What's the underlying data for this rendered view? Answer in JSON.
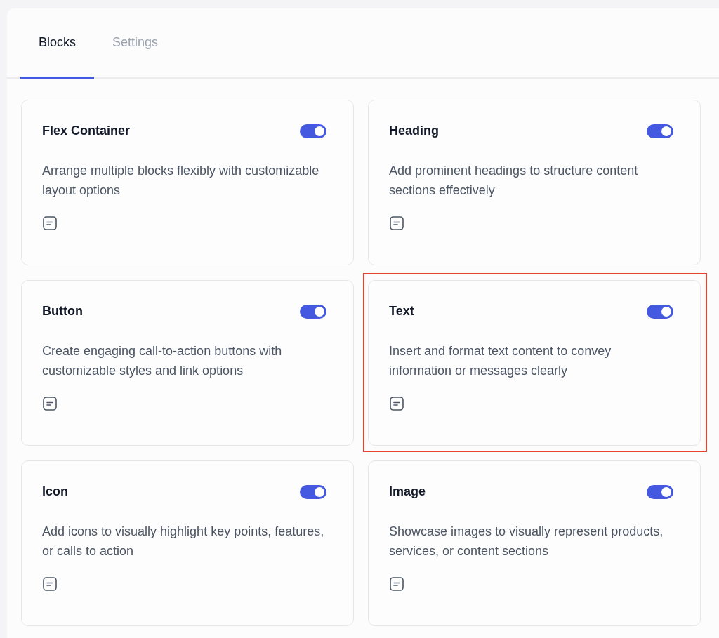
{
  "tabs": [
    {
      "label": "Blocks",
      "selected": true
    },
    {
      "label": "Settings",
      "selected": false
    }
  ],
  "blocks": [
    {
      "title": "Flex Container",
      "description": "Arrange multiple blocks flexibly with customizable layout options",
      "on": true,
      "highlighted": false
    },
    {
      "title": "Heading",
      "description": "Add prominent headings to structure content sections effectively",
      "on": true,
      "highlighted": false
    },
    {
      "title": "Button",
      "description": "Create engaging call-to-action buttons with customizable styles and link options",
      "on": true,
      "highlighted": false
    },
    {
      "title": "Text",
      "description": "Insert and format text content to convey information or messages clearly",
      "on": true,
      "highlighted": true
    },
    {
      "title": "Icon",
      "description": "Add icons to visually highlight key points, features, or calls to action",
      "on": true,
      "highlighted": false
    },
    {
      "title": "Image",
      "description": "Showcase images to visually represent products, services, or content sections",
      "on": true,
      "highlighted": false
    }
  ]
}
